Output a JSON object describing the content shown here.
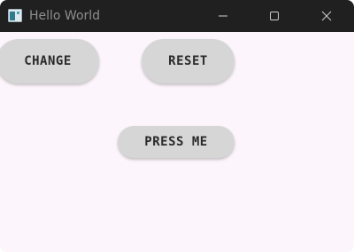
{
  "window": {
    "title": "Hello World",
    "icon": "app-window-icon",
    "controls": {
      "minimize_icon": "minimize-icon",
      "maximize_icon": "maximize-icon",
      "close_icon": "close-icon"
    }
  },
  "content": {
    "buttons": {
      "change_label": "CHANGE",
      "reset_label": "RESET",
      "press_label": "PRESS ME"
    }
  },
  "colors": {
    "titlebar": "#202020",
    "background": "#fcf5fb",
    "button": "#d6d6d6",
    "button_text": "#2a2a2a"
  }
}
